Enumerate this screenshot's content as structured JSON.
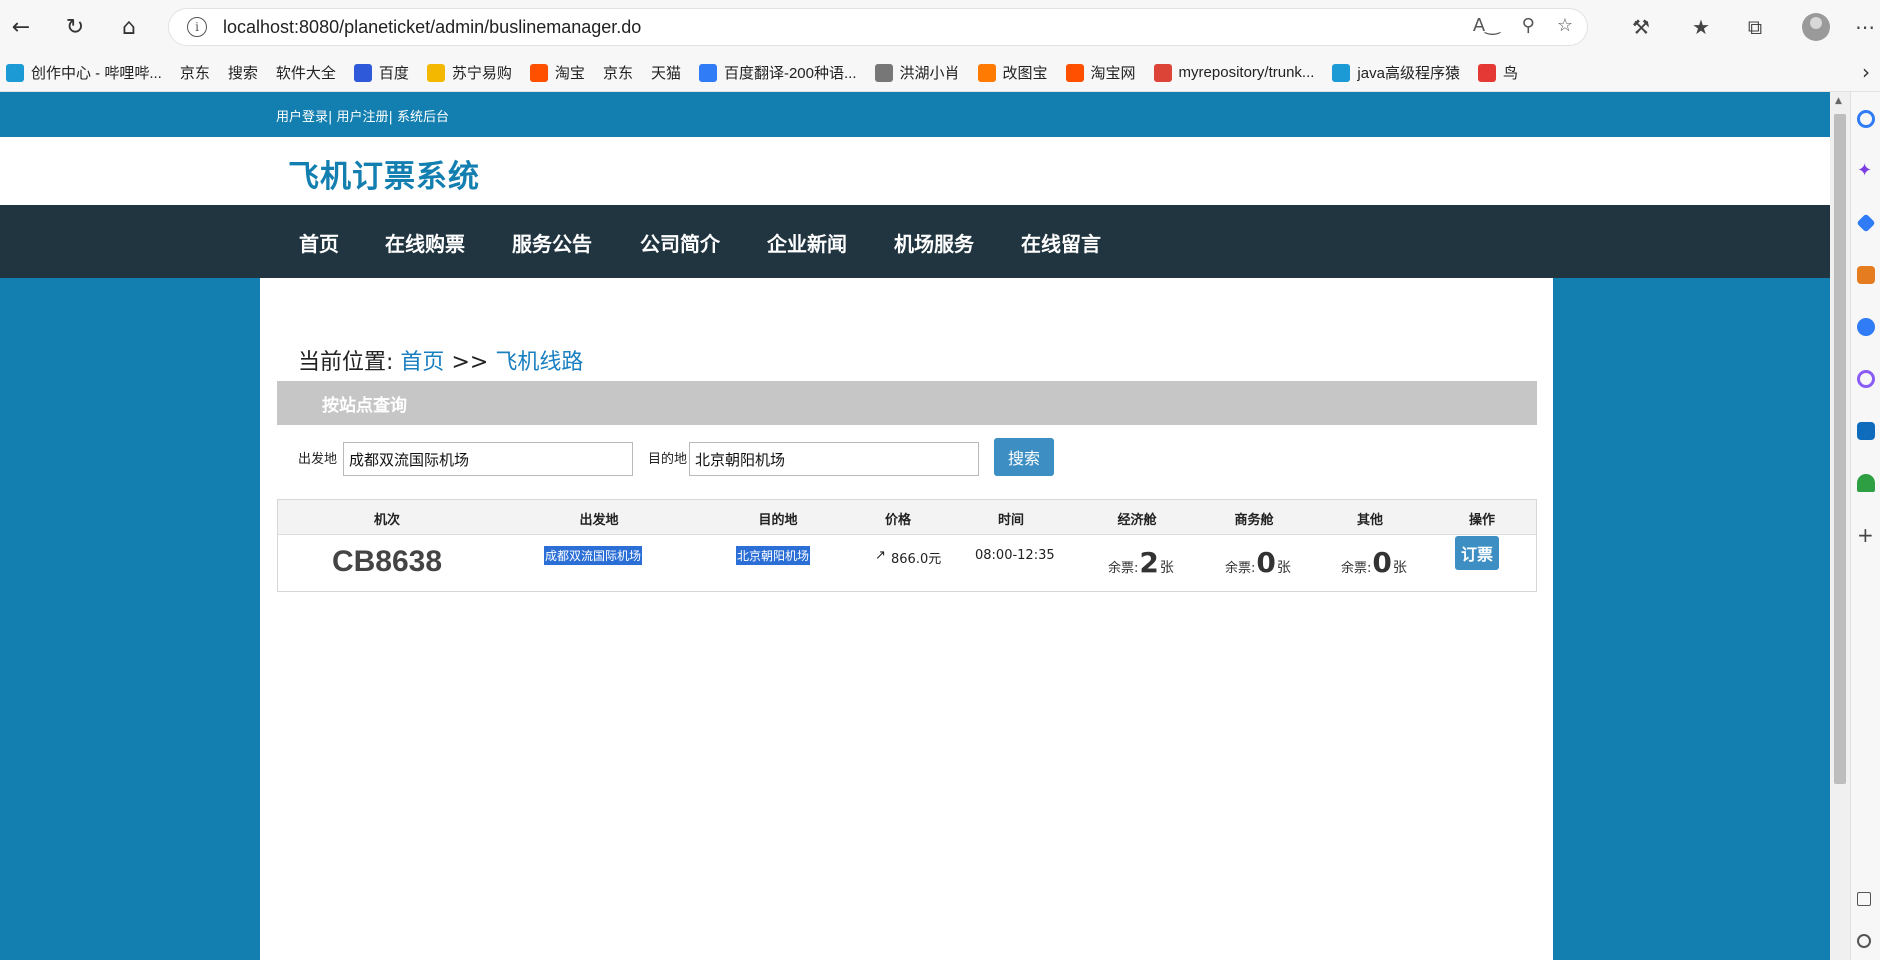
{
  "browser": {
    "url": "localhost:8080/planeticket/admin/buslinemanager.do",
    "bookmarks": [
      {
        "label": "创作中心 - 哔哩哔...",
        "icon": "bilibili-icon",
        "color": "#1b9ad6"
      },
      {
        "label": "京东",
        "icon": "page-icon",
        "color": ""
      },
      {
        "label": "搜索",
        "icon": "page-icon",
        "color": ""
      },
      {
        "label": "软件大全",
        "icon": "page-icon",
        "color": ""
      },
      {
        "label": "百度",
        "icon": "baidu-icon",
        "color": "#2e59d9"
      },
      {
        "label": "苏宁易购",
        "icon": "suning-icon",
        "color": "#f5b800"
      },
      {
        "label": "淘宝",
        "icon": "taobao-icon",
        "color": "#ff5000"
      },
      {
        "label": "京东",
        "icon": "page-icon",
        "color": ""
      },
      {
        "label": "天猫",
        "icon": "page-icon",
        "color": ""
      },
      {
        "label": "百度翻译-200种语...",
        "icon": "translate-icon",
        "color": "#2f7cf6"
      },
      {
        "label": "洪湖小肖",
        "icon": "feather-icon",
        "color": "#777777"
      },
      {
        "label": "改图宝",
        "icon": "gaitubao-icon",
        "color": "#ff7a00"
      },
      {
        "label": "淘宝网",
        "icon": "taobao-icon",
        "color": "#ff5000"
      },
      {
        "label": "myrepository/trunk...",
        "icon": "chrome-icon",
        "color": "#db4437"
      },
      {
        "label": "java高级程序猿",
        "icon": "bilibili-icon",
        "color": "#1b9ad6"
      },
      {
        "label": "鸟",
        "icon": "bird-icon",
        "color": "#e53935"
      }
    ]
  },
  "site": {
    "top_links": "用户登录| 用户注册| 系统后台",
    "title": "飞机订票系统",
    "nav": [
      "首页",
      "在线购票",
      "服务公告",
      "公司简介",
      "企业新闻",
      "机场服务",
      "在线留言"
    ]
  },
  "breadcrumb": {
    "prefix": "当前位置:",
    "home": "首页",
    "sep": ">>",
    "current": "飞机线路"
  },
  "search": {
    "section_title": "按站点查询",
    "from_label": "出发地",
    "from_value": "成都双流国际机场",
    "to_label": "目的地",
    "to_value": "北京朝阳机场",
    "button": "搜索"
  },
  "table": {
    "headers": [
      "机次",
      "出发地",
      "目的地",
      "价格",
      "时间",
      "经济舱",
      "商务舱",
      "其他",
      "操作"
    ],
    "row": {
      "flight_no": "CB8638",
      "from": "成都双流国际机场",
      "to": "北京朝阳机场",
      "price": "866.0元",
      "time": "08:00-12:35",
      "remain_prefix": "余票:",
      "remain_suffix": "张",
      "economy": "2",
      "business": "0",
      "other": "0",
      "action": "订票"
    }
  }
}
